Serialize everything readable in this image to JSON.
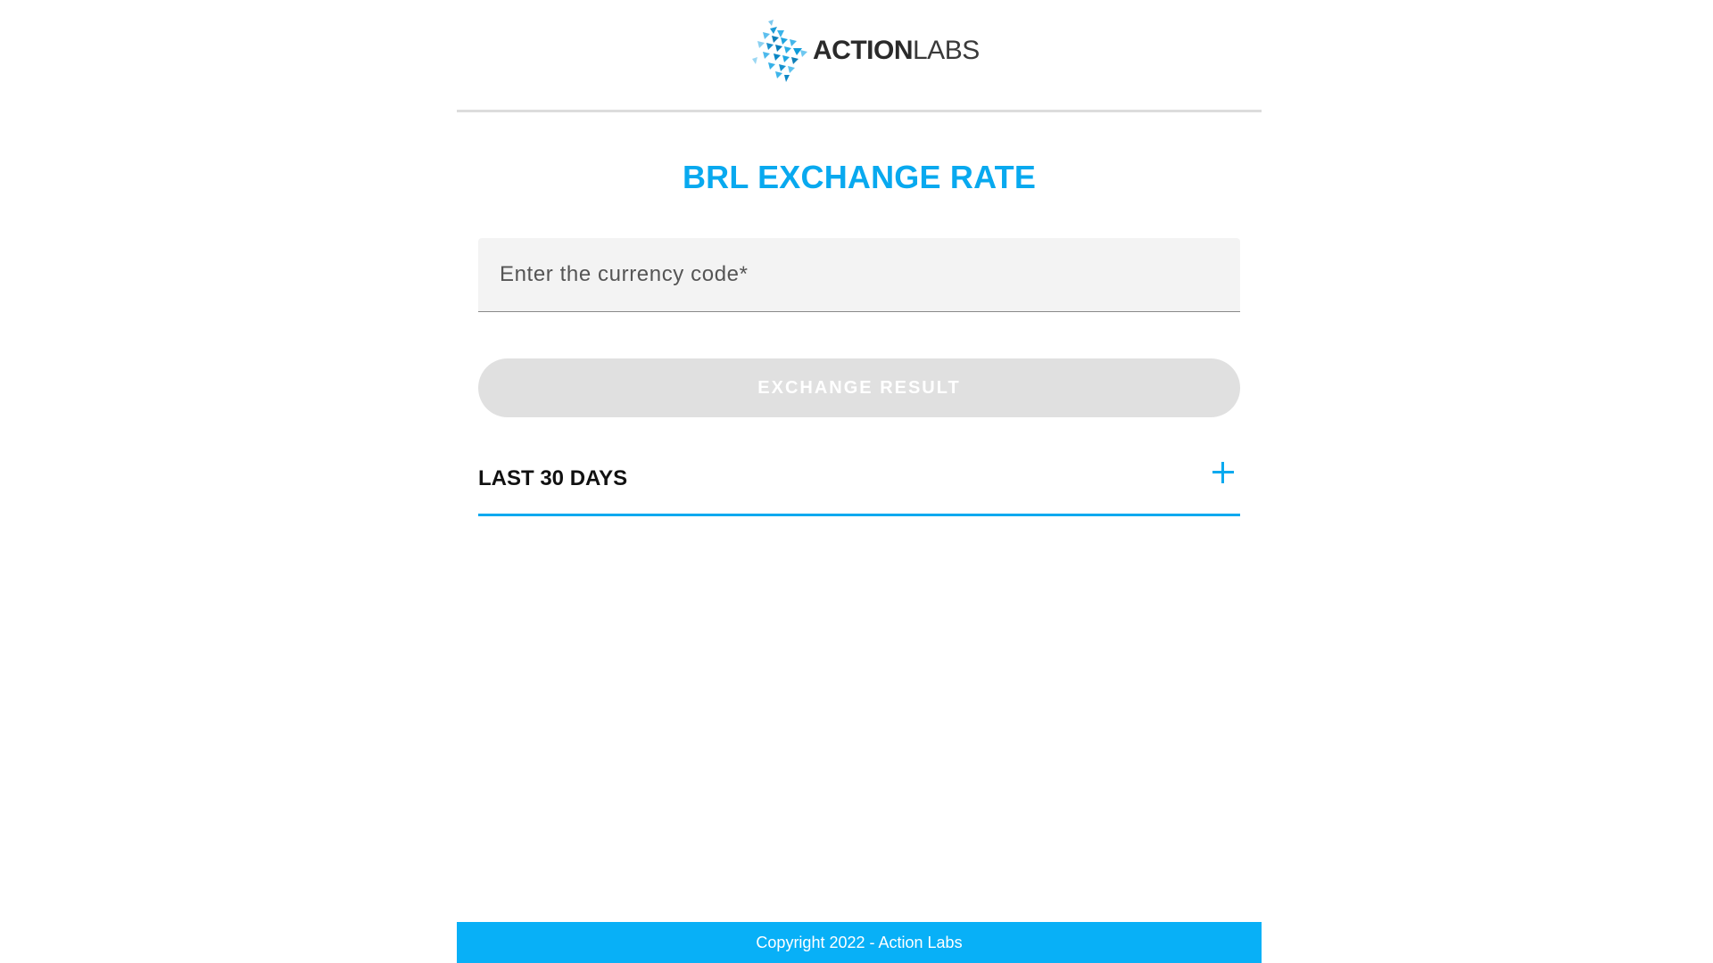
{
  "header": {
    "logo": {
      "text_bold": "ACTION",
      "text_light": "LABS"
    }
  },
  "main": {
    "title": "BRL EXCHANGE RATE",
    "currency_input": {
      "value": "",
      "placeholder": "Enter the currency code*"
    },
    "exchange_button_label": "EXCHANGE RESULT",
    "accordion": {
      "label": "LAST 30 DAYS",
      "expanded": false,
      "toggle_icon": "plus-icon"
    }
  },
  "footer": {
    "copyright": "Copyright 2022 - Action Labs"
  },
  "colors": {
    "accent": "#08a9ef",
    "footer_bg": "#08b0f7",
    "button_disabled_bg": "#e0e0e0",
    "input_bg": "#f3f3f3"
  }
}
